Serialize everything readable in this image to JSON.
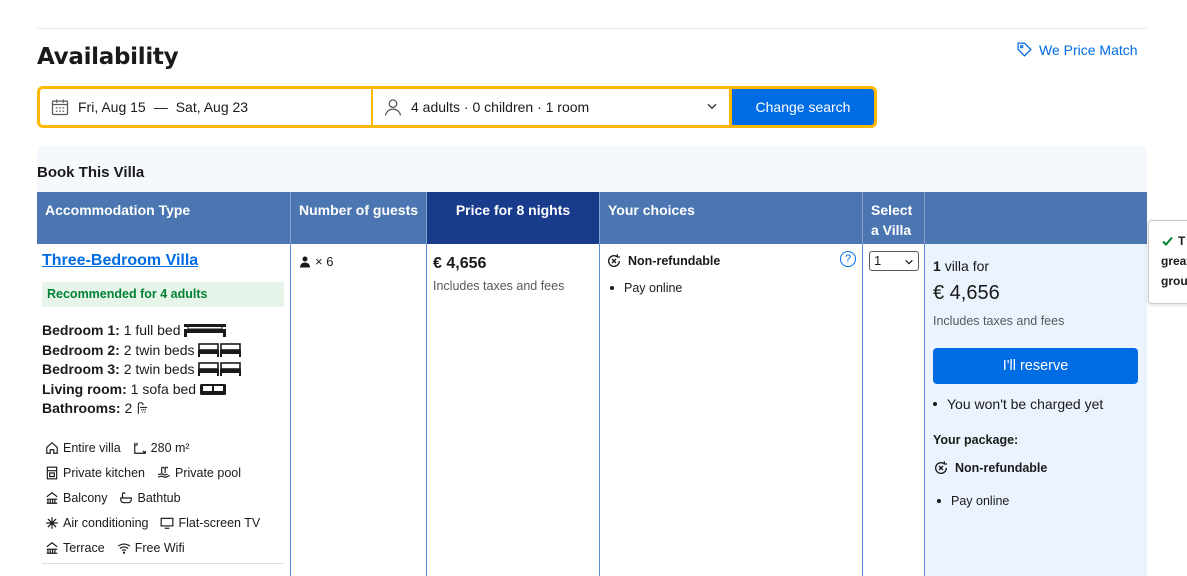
{
  "header": {
    "title": "Availability",
    "price_match": "We Price Match"
  },
  "search": {
    "check_in": "Fri, Aug 15",
    "separator": "—",
    "check_out": "Sat, Aug 23",
    "guests": "4 adults · 0 children · 1 room",
    "button": "Change search"
  },
  "book": {
    "title": "Book This Villa",
    "columns": [
      "Accommodation Type",
      "Number of guests",
      "Price for 8 nights",
      "Your choices",
      "Select a Villa"
    ]
  },
  "room": {
    "name": "Three-Bedroom Villa",
    "recommended": "Recommended for 4 adults",
    "beds": [
      {
        "label": "Bedroom 1:",
        "value": "1 full bed"
      },
      {
        "label": "Bedroom 2:",
        "value": "2 twin beds"
      },
      {
        "label": "Bedroom 3:",
        "value": "2 twin beds"
      },
      {
        "label": "Living room:",
        "value": "1 sofa bed"
      },
      {
        "label": "Bathrooms:",
        "value": "2"
      }
    ],
    "facilities": [
      [
        "Entire villa",
        "280 m²"
      ],
      [
        "Private kitchen",
        "Private pool"
      ],
      [
        "Balcony",
        "Bathtub"
      ],
      [
        "Air conditioning",
        "Flat-screen TV"
      ],
      [
        "Terrace",
        "Free Wifi"
      ]
    ],
    "guests": "× 6",
    "price": "€ 4,656",
    "price_note": "Includes taxes and fees",
    "choice": "Non-refundable",
    "choice_bullet": "Pay online",
    "select_value": "1"
  },
  "summary": {
    "count_bold": "1",
    "count_text": "villa for",
    "price": "€ 4,656",
    "note": "Includes taxes and fees",
    "button": "I'll reserve",
    "bullet": "You won't be charged yet",
    "package_label": "Your package:",
    "package_choice": "Non-refundable",
    "package_bullet": "Pay online"
  },
  "tooltip": {
    "lines": [
      "T",
      "great",
      "grou"
    ]
  },
  "colors": {
    "accent": "#006ce4",
    "header_blue": "#4c76b2",
    "header_dark": "#183b8c",
    "search_border": "#ffb700",
    "recommend_green": "#008234"
  }
}
